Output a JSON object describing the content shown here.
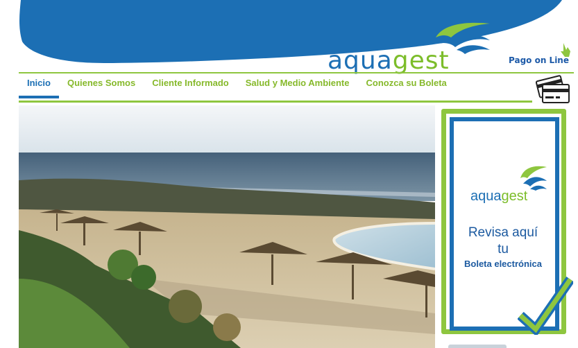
{
  "header": {
    "logo": {
      "part1": "aqua",
      "part2": "gest"
    },
    "pay_link": "Pago on Line"
  },
  "nav": {
    "items": [
      {
        "label": "Inicio",
        "active": true
      },
      {
        "label": "Quienes Somos",
        "active": false
      },
      {
        "label": "Cliente Informado",
        "active": false
      },
      {
        "label": "Salud y Medio Ambiente",
        "active": false
      },
      {
        "label": "Conozca su Boleta",
        "active": false
      }
    ]
  },
  "banner": {
    "logo": {
      "part1": "aqua",
      "part2": "gest"
    },
    "line1": "Revisa aquí",
    "line2": "tu",
    "line3": "Boleta electrónica"
  },
  "icons": {
    "card": "credit-card-icon",
    "pointer": "hand-pointer-icon",
    "check": "check-icon"
  },
  "colors": {
    "brand_blue": "#1c6fb4",
    "brand_green": "#8ec63f",
    "nav_text": "#86b92b"
  }
}
